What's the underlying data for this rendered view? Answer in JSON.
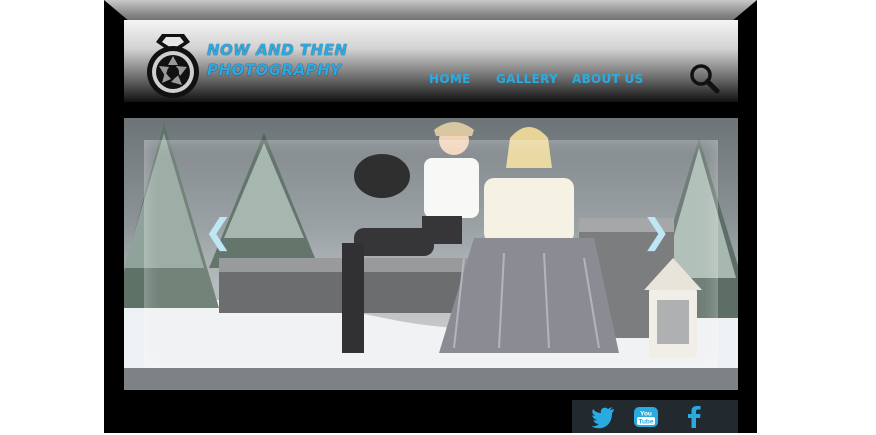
{
  "brand": {
    "line1": "NOW AND THEN",
    "line2": "PHOTOGRAPHY"
  },
  "nav": {
    "home": "HOME",
    "gallery": "GALLERY",
    "about": "ABOUT US"
  },
  "slider": {
    "prev_label": "❮",
    "next_label": "❯"
  },
  "social": {
    "youtube_text": "You Tube"
  },
  "colors": {
    "accent": "#29abe2",
    "frame": "#000000",
    "footer_bar": "#222a30"
  }
}
